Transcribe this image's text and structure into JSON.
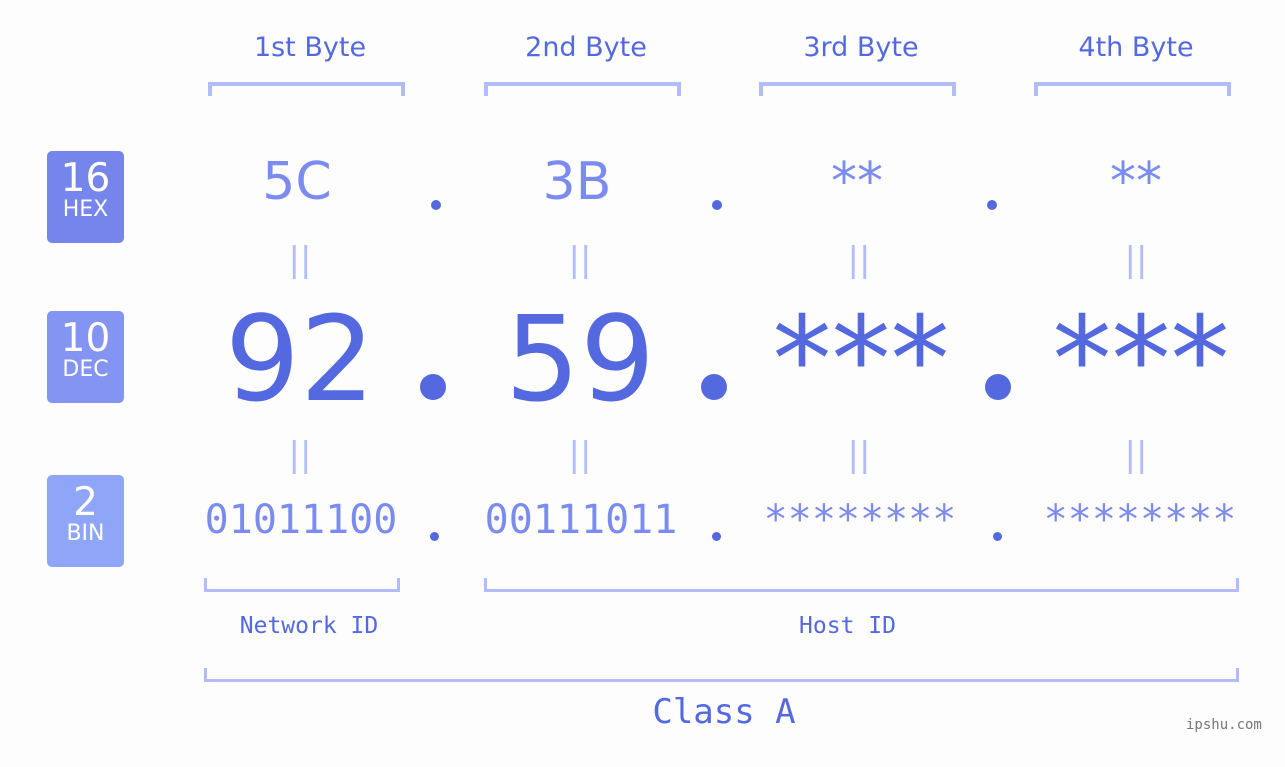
{
  "bytes": [
    {
      "label": "1st Byte",
      "hex": "5C",
      "dec": "92",
      "bin": "01011100"
    },
    {
      "label": "2nd Byte",
      "hex": "3B",
      "dec": "59",
      "bin": "00111011"
    },
    {
      "label": "3rd Byte",
      "hex": "**",
      "dec": "***",
      "bin": "********"
    },
    {
      "label": "4th Byte",
      "hex": "**",
      "dec": "***",
      "bin": "********"
    }
  ],
  "badges": {
    "hex": {
      "num": "16",
      "label": "HEX",
      "color": "#7585ec"
    },
    "dec": {
      "num": "10",
      "label": "DEC",
      "color": "#8394f2"
    },
    "bin": {
      "num": "2",
      "label": "BIN",
      "color": "#8fa6f8"
    }
  },
  "equals_symbol": "||",
  "network_id_label": "Network ID",
  "host_id_label": "Host ID",
  "class_label": "Class A",
  "watermark": "ipshu.com"
}
